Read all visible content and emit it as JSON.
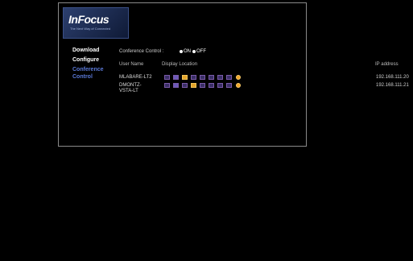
{
  "logo": {
    "brand": "InFocus",
    "tagline": "The Next Way of Connected"
  },
  "nav": {
    "download": "Download",
    "configure": "Configure",
    "conference": "Conference Control"
  },
  "conference_control": {
    "label": "Conference Control :",
    "on": "ON",
    "off": "OFF",
    "selected": "ON"
  },
  "table": {
    "headers": {
      "user": "User Name",
      "display": "Display Location",
      "ip": "IP address"
    },
    "rows": [
      {
        "user": "MLABARE-LT2",
        "ip": "192.168.111.20",
        "selected_location": 3
      },
      {
        "user": "DMONTZ-VSTA-LT",
        "ip": "192.168.111.21",
        "selected_location": 4
      }
    ],
    "location_icons": [
      "quad-top-left",
      "full-screen",
      "split-left",
      "split-right",
      "quad-top-right",
      "quad-bottom-left",
      "quad-bottom-right",
      "quad-all"
    ]
  },
  "colors": {
    "accent_nav": "#5a78d6",
    "selected_location": "#e3a42a"
  }
}
